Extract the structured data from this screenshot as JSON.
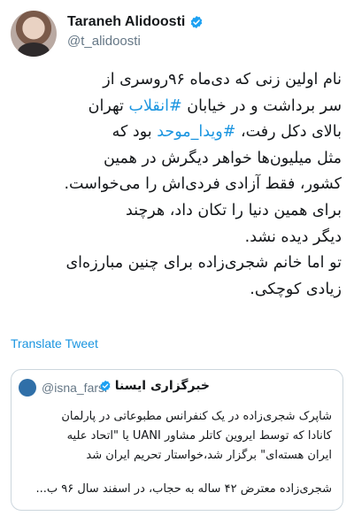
{
  "tweet": {
    "author": {
      "display_name": "Taraneh Alidoosti",
      "handle": "@t_alidoosti",
      "verified": true
    },
    "body_lines": [
      {
        "segments": [
          {
            "text": "نام اولین زنی که دی‌ماه ۹۶روسری از"
          }
        ]
      },
      {
        "segments": [
          {
            "text": "سر برداشت و در خیابان "
          },
          {
            "text": "#انقلاب",
            "hashtag": true
          },
          {
            "text": " تهران"
          }
        ]
      },
      {
        "segments": [
          {
            "text": "بالای دکل رفت، "
          },
          {
            "text": "#ویدا_موحد",
            "hashtag": true
          },
          {
            "text": " بود که"
          }
        ]
      },
      {
        "segments": [
          {
            "text": "مثل میلیون‌ها خواهر دیگرش در همین"
          }
        ]
      },
      {
        "segments": [
          {
            "text": "کشور، فقط آزادی فردی‌اش را می‌خواست."
          }
        ]
      },
      {
        "segments": [
          {
            "text": "برای همین دنیا را تکان داد، هرچند"
          }
        ]
      },
      {
        "segments": [
          {
            "text": "دیگر دیده نشد."
          }
        ]
      },
      {
        "segments": [
          {
            "text": "تو اما خانم شجری‌زاده برای چنین مبارزه‌ای"
          }
        ]
      },
      {
        "segments": [
          {
            "text": "زیادی کوچکی."
          }
        ]
      }
    ],
    "translate_label": "Translate Tweet"
  },
  "quote": {
    "name": "خبرگزاری ایسنا",
    "handle": "@isna_farsi",
    "verified": true,
    "lines": [
      "شاپرک شجری‌زاده در یک کنفرانس مطبوعاتی در پارلمان",
      "کانادا که توسط ایروین کاتلر مشاور UANI یا \"اتحاد علیه",
      "ایران هسته‌ای\" برگزار شد،خواستار تحریم ایران شد"
    ],
    "tail": "شجری‌زاده معترض ۴۲ ساله به حجاب، در اسفند سال ۹۶ ب..."
  },
  "colors": {
    "link": "#1b95e0",
    "verified": "#1da1f2",
    "muted": "#657786",
    "border": "#ccd6dd"
  },
  "icons": {
    "verified": "verified-badge-icon"
  }
}
